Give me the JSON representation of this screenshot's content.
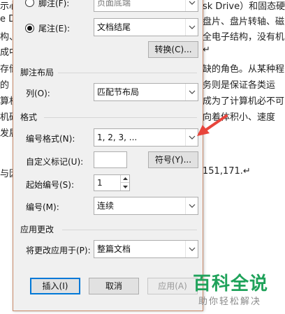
{
  "document": {
    "left_fragments": [
      "示心",
      "e Dr",
      "构、",
      "成中",
      "存储",
      "的",
      "算机",
      "机硬",
      "发展",
      "",
      "与因"
    ],
    "right_lines": [
      "sk Drive）和固态硬",
      "盘片、盘片转轴、磁",
      "全电子结构，没有机",
      "↵",
      "缺的角色。从某种程",
      "务则是保证各类运",
      "成为了计算机必不可",
      "向着体积小、速度",
      "",
      "",
      "151,171.↵"
    ]
  },
  "dialog": {
    "footnote": {
      "label": "脚注(F):",
      "value": "页面底端"
    },
    "endnote": {
      "label": "尾注(E):",
      "value": "文档结尾",
      "selected": true
    },
    "convert_button": "转换(C)...",
    "layout_section": "脚注布局",
    "columns": {
      "label": "列(O):",
      "value": "匹配节布局"
    },
    "format_section": "格式",
    "number_format": {
      "label": "编号格式(N):",
      "value": "1, 2, 3, ..."
    },
    "custom_mark": {
      "label": "自定义标记(U):",
      "value": ""
    },
    "symbol_button": "符号(Y)...",
    "start_at": {
      "label": "起始编号(S):",
      "value": "1"
    },
    "numbering": {
      "label": "编号(M):",
      "value": "连续"
    },
    "apply_section": "应用更改",
    "apply_to": {
      "label": "将更改应用于(P):",
      "value": "整篇文档"
    },
    "insert_button": "插入(I)",
    "cancel_button": "取消",
    "apply_button": "应用(A)"
  },
  "watermark": {
    "title": "百科全说",
    "subtitle": "助你轻松解决"
  },
  "colors": {
    "accent": "#0078d7",
    "annotation_arrow": "#e8453c",
    "watermark": "#1fa25a"
  }
}
